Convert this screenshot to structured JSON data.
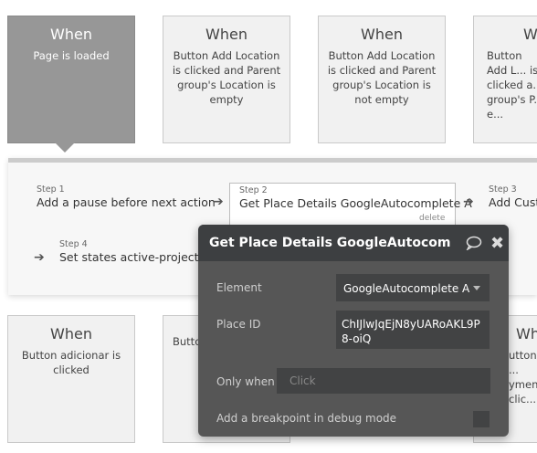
{
  "cards_top": [
    {
      "when": "When",
      "desc": "Page is loaded"
    },
    {
      "when": "When",
      "desc": "Button Add Location is clicked and Parent group's Location is empty"
    },
    {
      "when": "When",
      "desc": "Button Add Location is clicked and Parent group's Location is not empty"
    },
    {
      "when": "Wh",
      "desc": "Button Add L... is clicked a... group's P... e..."
    }
  ],
  "cards_bottom": [
    {
      "when": "When",
      "desc": "Button adicionar is clicked"
    },
    {
      "when": "",
      "desc": "Butto"
    },
    {
      "when": "Wh",
      "desc": "utton ... ymen... clic..."
    }
  ],
  "steps": [
    {
      "num": "Step 1",
      "title": "Add a pause before next action"
    },
    {
      "num": "Step 2",
      "title": "Get Place Details GoogleAutocomplete A",
      "delete": "delete"
    },
    {
      "num": "Step 3",
      "title": "Add Custo"
    },
    {
      "num": "Step 4",
      "title": "Set states active-project... o"
    }
  ],
  "dialog": {
    "title": "Get Place Details GoogleAutocom",
    "element_label": "Element",
    "element_value": "GoogleAutocomplete A",
    "place_id_label": "Place ID",
    "place_id_value": "ChIJlwJqEjN8yUARoAKL9P8-oiQ",
    "only_when_label": "Only when",
    "only_when_placeholder": "Click",
    "breakpoint_label": "Add a breakpoint in debug mode"
  }
}
